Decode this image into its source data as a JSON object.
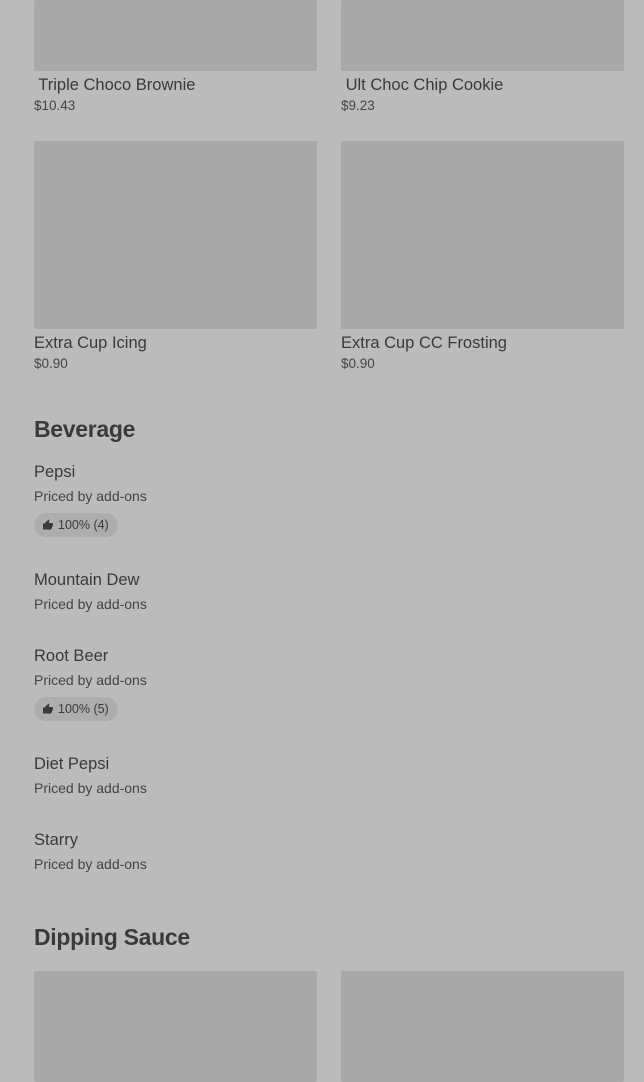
{
  "top_items": [
    {
      "name": " Triple Choco Brownie",
      "price": "$10.43"
    },
    {
      "name": " Ult Choc Chip Cookie",
      "price": "$9.23"
    },
    {
      "name": "Extra Cup Icing",
      "price": "$0.90"
    },
    {
      "name": "Extra Cup CC Frosting",
      "price": "$0.90"
    }
  ],
  "beverage": {
    "title": "Beverage",
    "items": [
      {
        "name": "Pepsi",
        "desc": "Priced by add-ons",
        "rating": "100% (4)"
      },
      {
        "name": "Mountain Dew",
        "desc": "Priced by add-ons"
      },
      {
        "name": "Root Beer",
        "desc": "Priced by add-ons",
        "rating": "100% (5)"
      },
      {
        "name": "Diet Pepsi",
        "desc": "Priced by add-ons"
      },
      {
        "name": "Starry",
        "desc": "Priced by add-ons"
      }
    ]
  },
  "dipping_sauce": {
    "title": "Dipping Sauce"
  },
  "icons": {
    "rating": "thumbs-up-icon"
  },
  "colors": {
    "background": "#bbbbbb",
    "image_placeholder": "#a8a8a8",
    "badge": "#adadad",
    "text": "#3a3a3a"
  }
}
